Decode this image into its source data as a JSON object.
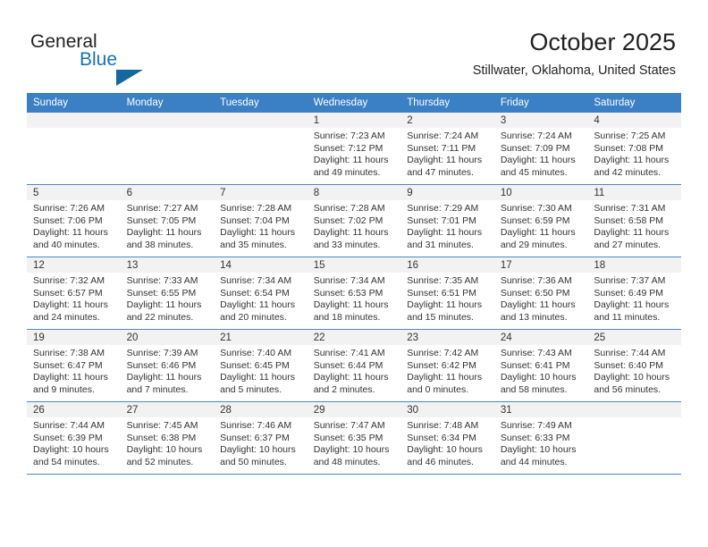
{
  "brand": {
    "line1": "General",
    "line2": "Blue",
    "triangle_color": "#15679f",
    "blue_color": "#1472b8"
  },
  "header": {
    "title": "October 2025",
    "subtitle": "Stillwater, Oklahoma, United States",
    "header_bg": "#3b7fc4"
  },
  "calendar": {
    "weekday_headers": [
      "Sunday",
      "Monday",
      "Tuesday",
      "Wednesday",
      "Thursday",
      "Friday",
      "Saturday"
    ],
    "weeks": [
      [
        {
          "day": "",
          "lines": [
            "",
            "",
            "",
            ""
          ]
        },
        {
          "day": "",
          "lines": [
            "",
            "",
            "",
            ""
          ]
        },
        {
          "day": "",
          "lines": [
            "",
            "",
            "",
            ""
          ]
        },
        {
          "day": "1",
          "lines": [
            "Sunrise: 7:23 AM",
            "Sunset: 7:12 PM",
            "Daylight: 11 hours",
            "and 49 minutes."
          ]
        },
        {
          "day": "2",
          "lines": [
            "Sunrise: 7:24 AM",
            "Sunset: 7:11 PM",
            "Daylight: 11 hours",
            "and 47 minutes."
          ]
        },
        {
          "day": "3",
          "lines": [
            "Sunrise: 7:24 AM",
            "Sunset: 7:09 PM",
            "Daylight: 11 hours",
            "and 45 minutes."
          ]
        },
        {
          "day": "4",
          "lines": [
            "Sunrise: 7:25 AM",
            "Sunset: 7:08 PM",
            "Daylight: 11 hours",
            "and 42 minutes."
          ]
        }
      ],
      [
        {
          "day": "5",
          "lines": [
            "Sunrise: 7:26 AM",
            "Sunset: 7:06 PM",
            "Daylight: 11 hours",
            "and 40 minutes."
          ]
        },
        {
          "day": "6",
          "lines": [
            "Sunrise: 7:27 AM",
            "Sunset: 7:05 PM",
            "Daylight: 11 hours",
            "and 38 minutes."
          ]
        },
        {
          "day": "7",
          "lines": [
            "Sunrise: 7:28 AM",
            "Sunset: 7:04 PM",
            "Daylight: 11 hours",
            "and 35 minutes."
          ]
        },
        {
          "day": "8",
          "lines": [
            "Sunrise: 7:28 AM",
            "Sunset: 7:02 PM",
            "Daylight: 11 hours",
            "and 33 minutes."
          ]
        },
        {
          "day": "9",
          "lines": [
            "Sunrise: 7:29 AM",
            "Sunset: 7:01 PM",
            "Daylight: 11 hours",
            "and 31 minutes."
          ]
        },
        {
          "day": "10",
          "lines": [
            "Sunrise: 7:30 AM",
            "Sunset: 6:59 PM",
            "Daylight: 11 hours",
            "and 29 minutes."
          ]
        },
        {
          "day": "11",
          "lines": [
            "Sunrise: 7:31 AM",
            "Sunset: 6:58 PM",
            "Daylight: 11 hours",
            "and 27 minutes."
          ]
        }
      ],
      [
        {
          "day": "12",
          "lines": [
            "Sunrise: 7:32 AM",
            "Sunset: 6:57 PM",
            "Daylight: 11 hours",
            "and 24 minutes."
          ]
        },
        {
          "day": "13",
          "lines": [
            "Sunrise: 7:33 AM",
            "Sunset: 6:55 PM",
            "Daylight: 11 hours",
            "and 22 minutes."
          ]
        },
        {
          "day": "14",
          "lines": [
            "Sunrise: 7:34 AM",
            "Sunset: 6:54 PM",
            "Daylight: 11 hours",
            "and 20 minutes."
          ]
        },
        {
          "day": "15",
          "lines": [
            "Sunrise: 7:34 AM",
            "Sunset: 6:53 PM",
            "Daylight: 11 hours",
            "and 18 minutes."
          ]
        },
        {
          "day": "16",
          "lines": [
            "Sunrise: 7:35 AM",
            "Sunset: 6:51 PM",
            "Daylight: 11 hours",
            "and 15 minutes."
          ]
        },
        {
          "day": "17",
          "lines": [
            "Sunrise: 7:36 AM",
            "Sunset: 6:50 PM",
            "Daylight: 11 hours",
            "and 13 minutes."
          ]
        },
        {
          "day": "18",
          "lines": [
            "Sunrise: 7:37 AM",
            "Sunset: 6:49 PM",
            "Daylight: 11 hours",
            "and 11 minutes."
          ]
        }
      ],
      [
        {
          "day": "19",
          "lines": [
            "Sunrise: 7:38 AM",
            "Sunset: 6:47 PM",
            "Daylight: 11 hours",
            "and 9 minutes."
          ]
        },
        {
          "day": "20",
          "lines": [
            "Sunrise: 7:39 AM",
            "Sunset: 6:46 PM",
            "Daylight: 11 hours",
            "and 7 minutes."
          ]
        },
        {
          "day": "21",
          "lines": [
            "Sunrise: 7:40 AM",
            "Sunset: 6:45 PM",
            "Daylight: 11 hours",
            "and 5 minutes."
          ]
        },
        {
          "day": "22",
          "lines": [
            "Sunrise: 7:41 AM",
            "Sunset: 6:44 PM",
            "Daylight: 11 hours",
            "and 2 minutes."
          ]
        },
        {
          "day": "23",
          "lines": [
            "Sunrise: 7:42 AM",
            "Sunset: 6:42 PM",
            "Daylight: 11 hours",
            "and 0 minutes."
          ]
        },
        {
          "day": "24",
          "lines": [
            "Sunrise: 7:43 AM",
            "Sunset: 6:41 PM",
            "Daylight: 10 hours",
            "and 58 minutes."
          ]
        },
        {
          "day": "25",
          "lines": [
            "Sunrise: 7:44 AM",
            "Sunset: 6:40 PM",
            "Daylight: 10 hours",
            "and 56 minutes."
          ]
        }
      ],
      [
        {
          "day": "26",
          "lines": [
            "Sunrise: 7:44 AM",
            "Sunset: 6:39 PM",
            "Daylight: 10 hours",
            "and 54 minutes."
          ]
        },
        {
          "day": "27",
          "lines": [
            "Sunrise: 7:45 AM",
            "Sunset: 6:38 PM",
            "Daylight: 10 hours",
            "and 52 minutes."
          ]
        },
        {
          "day": "28",
          "lines": [
            "Sunrise: 7:46 AM",
            "Sunset: 6:37 PM",
            "Daylight: 10 hours",
            "and 50 minutes."
          ]
        },
        {
          "day": "29",
          "lines": [
            "Sunrise: 7:47 AM",
            "Sunset: 6:35 PM",
            "Daylight: 10 hours",
            "and 48 minutes."
          ]
        },
        {
          "day": "30",
          "lines": [
            "Sunrise: 7:48 AM",
            "Sunset: 6:34 PM",
            "Daylight: 10 hours",
            "and 46 minutes."
          ]
        },
        {
          "day": "31",
          "lines": [
            "Sunrise: 7:49 AM",
            "Sunset: 6:33 PM",
            "Daylight: 10 hours",
            "and 44 minutes."
          ]
        },
        {
          "day": "",
          "lines": [
            "",
            "",
            "",
            ""
          ]
        }
      ]
    ]
  }
}
